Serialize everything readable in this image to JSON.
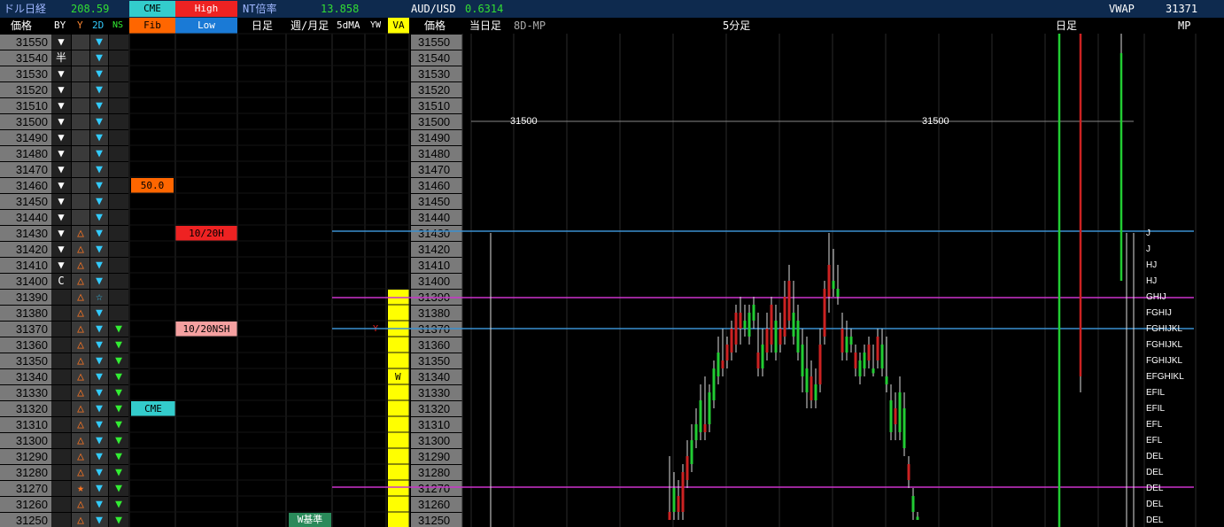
{
  "header": {
    "dollar_nikkei_label": "ドル日経",
    "dollar_nikkei_value": "208.59",
    "cme_label": "CME",
    "high_label": "High",
    "nt_label": "NT倍率",
    "nt_value": "13.858",
    "audusd_label": "AUD/USD",
    "audusd_value": "0.6314",
    "vwap_label": "VWAP",
    "vwap_value": "31371"
  },
  "columns": {
    "price": "価格",
    "by": "BY",
    "y": "Y",
    "d2": "2D",
    "ns": "NS",
    "fib": "Fib",
    "low": "Low",
    "daily": "日足",
    "weekly_monthly": "週/月足",
    "ma5": "5dMA",
    "yw": "YW",
    "va": "VA",
    "price2": "価格",
    "today": "当日足",
    "mp8d": "8D-MP",
    "min5": "5分足",
    "daily2": "日足",
    "mp": "MP"
  },
  "prices": [
    "31550",
    "31540",
    "31530",
    "31520",
    "31510",
    "31500",
    "31490",
    "31480",
    "31470",
    "31460",
    "31450",
    "31440",
    "31430",
    "31420",
    "31410",
    "31400",
    "31390",
    "31380",
    "31370",
    "31360",
    "31350",
    "31340",
    "31330",
    "31320",
    "31310",
    "31300",
    "31290",
    "31280",
    "31270",
    "31260",
    "31250"
  ],
  "by_markers": [
    "▼",
    "半",
    "▼",
    "▼",
    "▼",
    "▼",
    "▼",
    "▼",
    "▼",
    "▼",
    "▼",
    "▼",
    "▼",
    "▼",
    "▼",
    "C",
    "",
    "",
    "",
    "",
    "",
    "",
    "",
    "",
    "",
    "",
    "",
    "",
    "",
    "",
    ""
  ],
  "y_markers": [
    "",
    "",
    "",
    "",
    "",
    "",
    "",
    "",
    "",
    "",
    "",
    "",
    "△",
    "△",
    "△",
    "△",
    "△",
    "△",
    "△",
    "△",
    "△",
    "△",
    "△",
    "△",
    "△",
    "△",
    "△",
    "△",
    "★",
    "△",
    "△"
  ],
  "d2_markers": [
    "▼",
    "▼",
    "▼",
    "▼",
    "▼",
    "▼",
    "▼",
    "▼",
    "▼",
    "▼",
    "▼",
    "▼",
    "▼",
    "▼",
    "▼",
    "▼",
    "☆",
    "▼",
    "▼",
    "▼",
    "▼",
    "▼",
    "▼",
    "▼",
    "▼",
    "▼",
    "▼",
    "▼",
    "▼",
    "▼",
    "▼"
  ],
  "ns_markers": [
    "",
    "",
    "",
    "",
    "",
    "",
    "",
    "",
    "",
    "",
    "",
    "",
    "",
    "",
    "",
    "",
    "",
    "",
    "▼",
    "▼",
    "▼",
    "▼",
    "▼",
    "▼",
    "▼",
    "▼",
    "▼",
    "▼",
    "▼",
    "▼",
    "▼"
  ],
  "levels": {
    "fib50": "50.0",
    "h10_20": "10/20H",
    "nsh10_20": "10/20NSH",
    "cme": "CME",
    "wkijun": "W基準",
    "y_mark": "Y",
    "w_mark": "W"
  },
  "line_label_31500": "31500",
  "mp_letters": [
    "J",
    "J",
    "HJ",
    "HJ",
    "GHIJ",
    "FGHIJ",
    "FGHIJKL",
    "FGHIJKL",
    "FGHIJKL",
    "EFGHIKL",
    "EFIL",
    "EFIL",
    "EFL",
    "EFL",
    "DEL",
    "DEL",
    "DEL",
    "DEL",
    "DEL"
  ],
  "colors": {
    "header_bg": "#0e2a4e",
    "cme": "#33cccc",
    "high": "#ee2222",
    "fib": "#ff6600",
    "low": "#1a7ad6",
    "va": "#ffff00",
    "up": "#22cc33",
    "down": "#cc2222",
    "hline_blue": "#3a8fd0",
    "hline_magenta": "#cc33cc"
  }
}
